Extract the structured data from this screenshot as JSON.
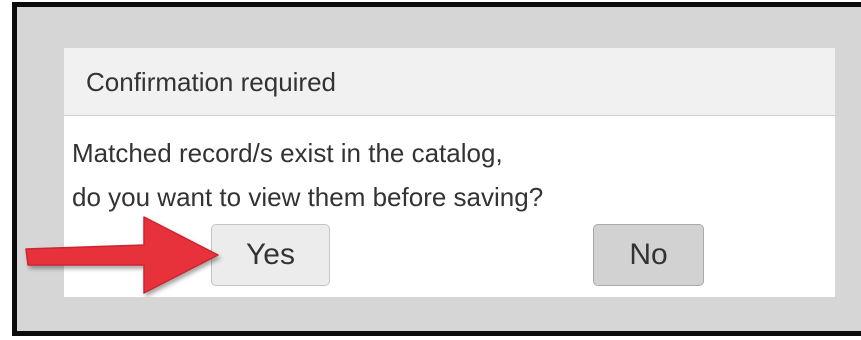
{
  "dialog": {
    "title": "Confirmation required",
    "message_lines": [
      "Matched record/s exist in the catalog,",
      "do you want to view them before saving?"
    ],
    "buttons": {
      "yes_label": "Yes",
      "no_label": "No"
    }
  },
  "annotation": {
    "arrow_color": "#e8323a",
    "points_to": "Yes"
  }
}
